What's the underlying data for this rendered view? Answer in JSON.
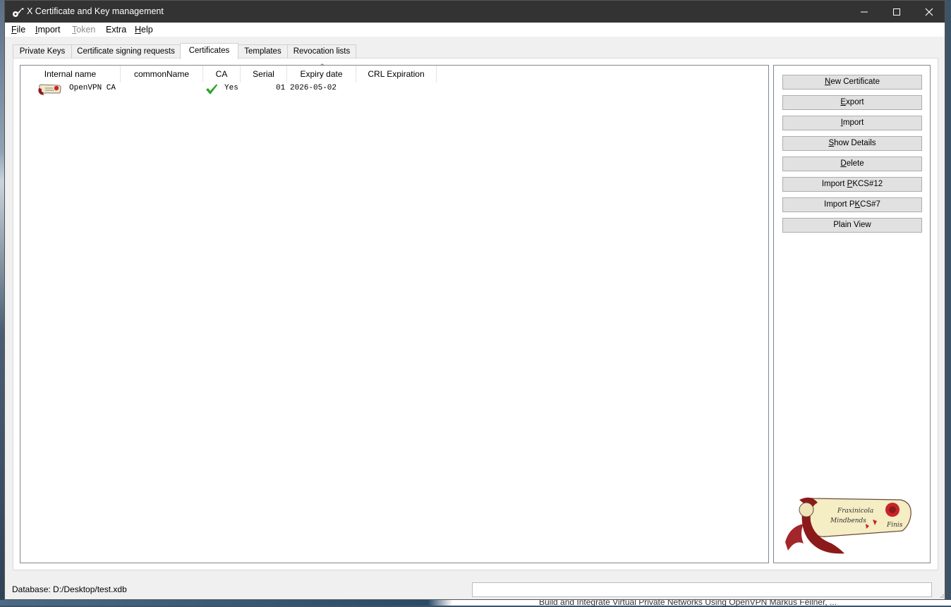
{
  "window": {
    "title": "X Certificate and Key management",
    "controls": {
      "minimize": "—",
      "maximize": "☐",
      "close": "✕"
    }
  },
  "menu": [
    {
      "label": "File",
      "mnemonic": "F",
      "rest": "ile",
      "enabled": true
    },
    {
      "label": "Import",
      "mnemonic": "I",
      "rest": "mport",
      "enabled": true
    },
    {
      "label": "Token",
      "mnemonic": "T",
      "rest": "oken",
      "enabled": false
    },
    {
      "label": "Extra",
      "mnemonic": "",
      "rest": "Extra",
      "enabled": true
    },
    {
      "label": "Help",
      "mnemonic": "H",
      "rest": "elp",
      "enabled": true
    }
  ],
  "tabs": [
    {
      "label": "Private Keys",
      "active": false
    },
    {
      "label": "Certificate signing requests",
      "active": false
    },
    {
      "label": "Certificates",
      "active": true
    },
    {
      "label": "Templates",
      "active": false
    },
    {
      "label": "Revocation lists",
      "active": false
    }
  ],
  "table": {
    "columns": [
      "Internal name",
      "commonName",
      "CA",
      "Serial",
      "Expiry date",
      "CRL Expiration"
    ],
    "sort_indicator": "^",
    "rows": [
      {
        "icon": "certificate-icon",
        "internal_name": "OpenVPN CA",
        "common_name": "",
        "ca_icon": "checkmark-icon",
        "ca": "Yes",
        "serial": "01",
        "expiry": "2026-05-02",
        "crl_expiration": ""
      }
    ]
  },
  "buttons": [
    {
      "pre": "",
      "u": "N",
      "post": "ew Certificate",
      "label": "New Certificate"
    },
    {
      "pre": "",
      "u": "E",
      "post": "xport",
      "label": "Export"
    },
    {
      "pre": "",
      "u": "I",
      "post": "mport",
      "label": "Import"
    },
    {
      "pre": "",
      "u": "S",
      "post": "how Details",
      "label": "Show Details"
    },
    {
      "pre": "",
      "u": "D",
      "post": "elete",
      "label": "Delete"
    },
    {
      "pre": "Import ",
      "u": "P",
      "post": "KCS#12",
      "label": "Import PKCS#12"
    },
    {
      "pre": "Import P",
      "u": "K",
      "post": "CS#7",
      "label": "Import PKCS#7"
    },
    {
      "pre": "",
      "u": "",
      "post": "Plain View",
      "label": "Plain View"
    }
  ],
  "logo": {
    "line1": "Fraxinicola",
    "line2": "Mindbends",
    "line3": "Finis"
  },
  "status": {
    "database": "Database: D:/Desktop/test.xdb"
  },
  "background_text": "Build and Integrate Virtual Private Networks Using OpenVPN Markus Feilner, ...",
  "colors": {
    "titlebar": "#333333",
    "window_bg": "#f0f0f0",
    "button_bg": "#e1e1e1",
    "check": "#2aa52a",
    "ribbon": "#8b1a1a"
  }
}
